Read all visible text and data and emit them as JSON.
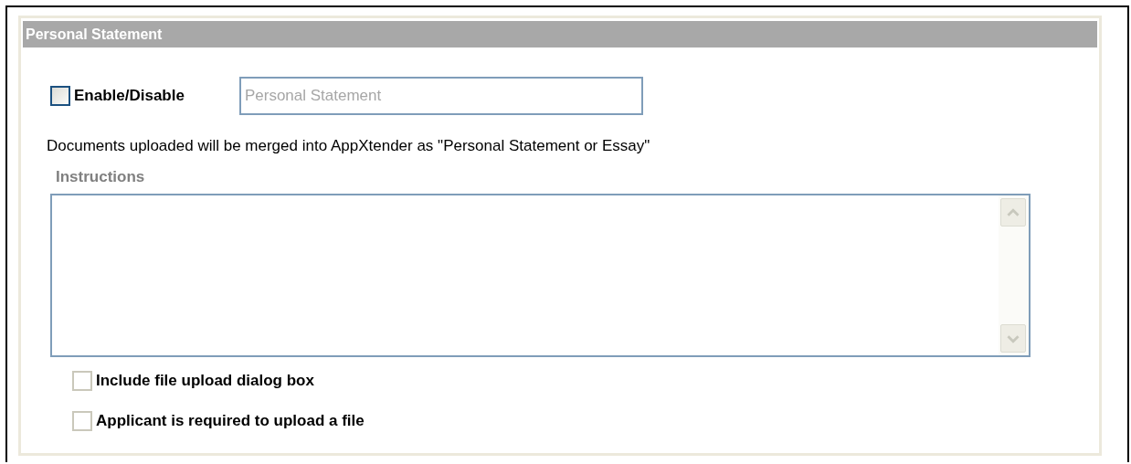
{
  "section": {
    "title": "Personal Statement"
  },
  "enable": {
    "label": "Enable/Disable",
    "checked": false
  },
  "name_field": {
    "value": "Personal Statement",
    "disabled": true
  },
  "note": "Documents uploaded will be merged into AppXtender as \"Personal Statement or Essay\"",
  "instructions": {
    "label": "Instructions"
  },
  "options": [
    {
      "label": "Include file upload dialog box",
      "checked": false,
      "disabled": true
    },
    {
      "label": "Applicant is required to upload a file",
      "checked": false,
      "disabled": true
    }
  ]
}
